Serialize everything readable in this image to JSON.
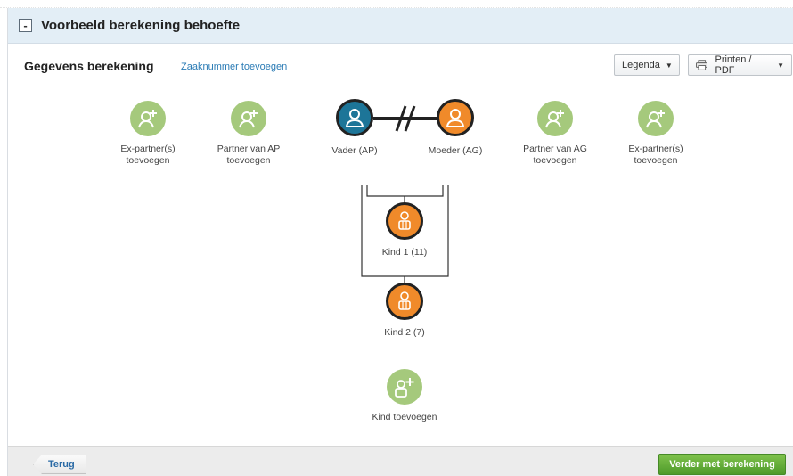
{
  "panel": {
    "collapse_symbol": "-",
    "title": "Voorbeeld berekening behoefte"
  },
  "section": {
    "title": "Gegevens berekening",
    "link": "Zaaknummer toevoegen"
  },
  "toolbar": {
    "legenda_label": "Legenda",
    "print_label": "Printen / PDF",
    "caret": "▼"
  },
  "parents_row": [
    {
      "label_line1": "Ex-partner(s)",
      "label_line2": "toevoegen",
      "icon": "add-person-icon"
    },
    {
      "label_line1": "Partner van AP",
      "label_line2": "toevoegen",
      "icon": "add-person-icon"
    },
    {
      "label_line1": "Vader (AP)",
      "label_line2": "",
      "icon": "person-icon"
    },
    {
      "label_line1": "Moeder (AG)",
      "label_line2": "",
      "icon": "person-icon"
    },
    {
      "label_line1": "Partner van AG",
      "label_line2": "toevoegen",
      "icon": "add-person-icon"
    },
    {
      "label_line1": "Ex-partner(s)",
      "label_line2": "toevoegen",
      "icon": "add-person-icon"
    }
  ],
  "children": [
    {
      "label": "Kind 1 (11)",
      "icon": "child-icon"
    },
    {
      "label": "Kind 2 (7)",
      "icon": "child-icon"
    }
  ],
  "add_child": {
    "label": "Kind toevoegen",
    "icon": "add-child-icon"
  },
  "footer": {
    "back_label": "Terug",
    "next_label": "Verder met berekening"
  },
  "colors": {
    "header_bg": "#e3eef6",
    "green_add": "#a5c97c",
    "father": "#1d7598",
    "mother_child": "#f08a2a",
    "link": "#2a7bb5",
    "next_button": "#5aa832"
  }
}
